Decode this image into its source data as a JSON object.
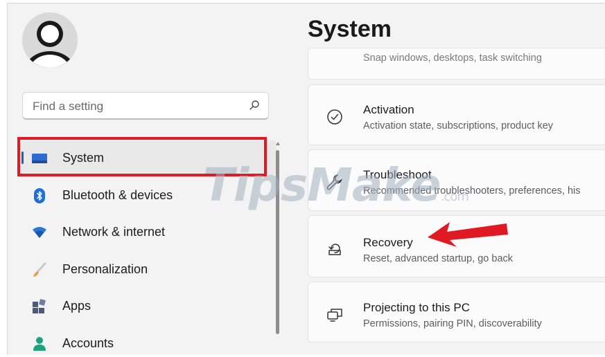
{
  "search": {
    "placeholder": "Find a setting"
  },
  "sidebar": {
    "items": [
      {
        "label": "System",
        "icon": "system-icon",
        "active": true
      },
      {
        "label": "Bluetooth & devices",
        "icon": "bluetooth-icon"
      },
      {
        "label": "Network & internet",
        "icon": "wifi-icon"
      },
      {
        "label": "Personalization",
        "icon": "brush-icon"
      },
      {
        "label": "Apps",
        "icon": "apps-icon"
      },
      {
        "label": "Accounts",
        "icon": "person-icon"
      }
    ]
  },
  "main": {
    "title": "System",
    "partial_subtitle": "Snap windows, desktops, task switching",
    "cards": [
      {
        "title": "Activation",
        "subtitle": "Activation state, subscriptions, product key",
        "icon": "check-circle-icon"
      },
      {
        "title": "Troubleshoot",
        "subtitle": "Recommended troubleshooters, preferences, his",
        "icon": "wrench-icon"
      },
      {
        "title": "Recovery",
        "subtitle": "Reset, advanced startup, go back",
        "icon": "recovery-icon"
      },
      {
        "title": "Projecting to this PC",
        "subtitle": "Permissions, pairing PIN, discoverability",
        "icon": "projector-icon"
      }
    ]
  },
  "watermark": {
    "text": "TipsMake",
    "suffix": ".com"
  },
  "colors": {
    "accent": "#1f5fbf",
    "highlight": "#e01a22",
    "arrow": "#e01a22"
  }
}
